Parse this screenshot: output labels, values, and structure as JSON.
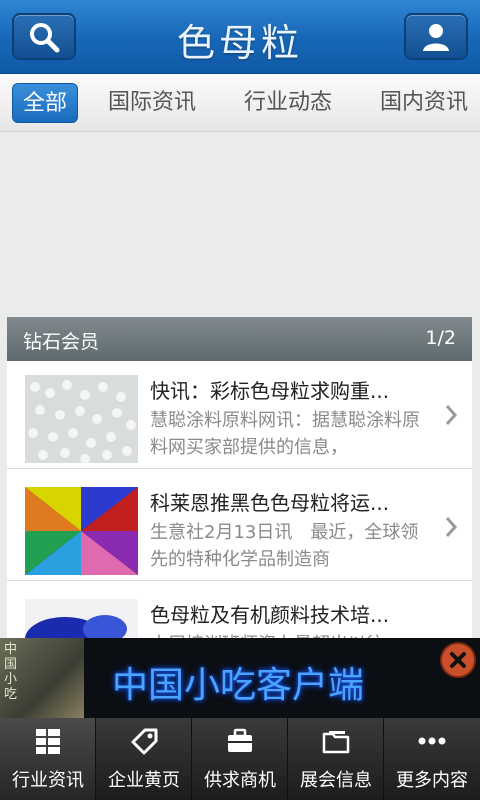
{
  "header": {
    "title": "色母粒",
    "search_icon": "search-icon",
    "user_icon": "user-icon"
  },
  "tabs": [
    {
      "label": "全部",
      "active": true
    },
    {
      "label": "国际资讯",
      "active": false
    },
    {
      "label": "行业动态",
      "active": false
    },
    {
      "label": "国内资讯",
      "active": false
    }
  ],
  "section": {
    "title": "钻石会员",
    "page": "1/2"
  },
  "items": [
    {
      "title": "快讯：彩标色母粒求购重...",
      "desc": "慧聪涂料原料网讯：据慧聪涂料原料网买家部提供的信息，"
    },
    {
      "title": "科莱恩推黑色色母粒将运...",
      "desc": "生意社2月13日讯　最近，全球领先的特种化学品制造商"
    },
    {
      "title": "色母粒及有机颜料技术培...",
      "desc": "本届培训班师资力量超出以往"
    }
  ],
  "ad": {
    "text": "中国小吃客户端",
    "image_text": "中国小吃",
    "close_icon": "close-icon"
  },
  "nav": [
    {
      "label": "行业资讯",
      "icon": "grid-icon",
      "active": true
    },
    {
      "label": "企业黄页",
      "icon": "tag-icon",
      "active": false
    },
    {
      "label": "供求商机",
      "icon": "briefcase-icon",
      "active": false
    },
    {
      "label": "展会信息",
      "icon": "folder-icon",
      "active": false
    },
    {
      "label": "更多内容",
      "icon": "more-icon",
      "active": false
    }
  ],
  "colors": {
    "brand": "#1766b6",
    "tab_active": "#2a7fd0",
    "section_head": "#6b7578"
  }
}
